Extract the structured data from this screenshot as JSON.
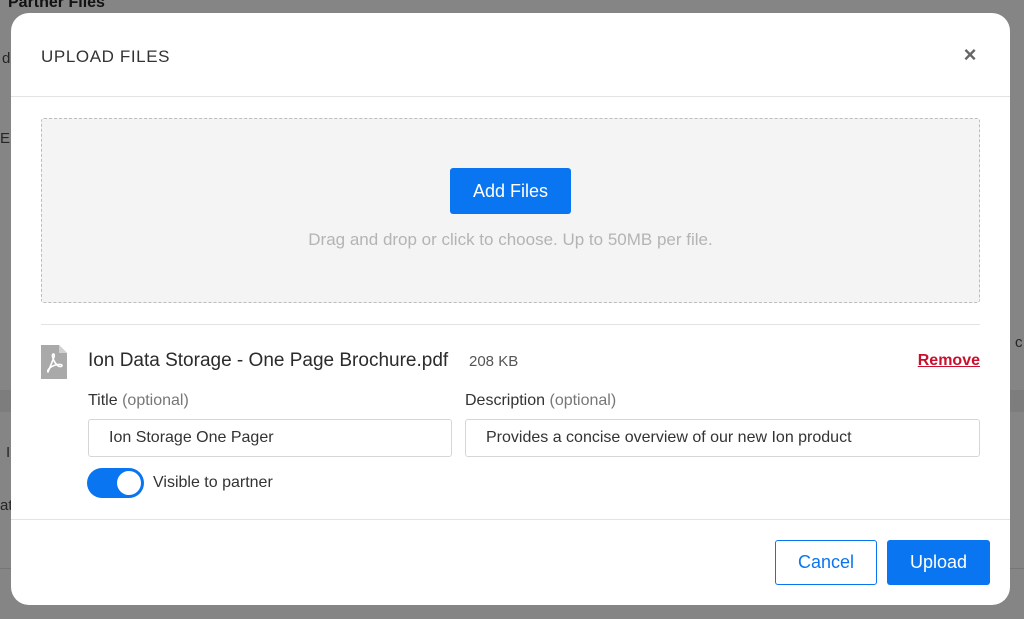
{
  "background": {
    "page_title": "Partner Files",
    "fragments": [
      "d",
      "E",
      "I",
      "at",
      "c"
    ]
  },
  "modal": {
    "title": "UPLOAD FILES",
    "close_icon": "close-icon",
    "close_glyph": "×"
  },
  "dropzone": {
    "add_files_label": "Add Files",
    "hint": "Drag and drop or click to choose. Up to 50MB per file."
  },
  "file": {
    "icon": "pdf-file-icon",
    "name": "Ion Data Storage - One Page Brochure.pdf",
    "size": "208 KB",
    "remove_label": "Remove",
    "title_label": "Title",
    "title_optional": "(optional)",
    "title_value": "Ion Storage One Pager",
    "description_label": "Description",
    "description_optional": "(optional)",
    "description_value": "Provides a concise overview of our new Ion product",
    "visible_label": "Visible to partner",
    "visible": true
  },
  "footer": {
    "cancel_label": "Cancel",
    "upload_label": "Upload"
  },
  "colors": {
    "accent": "#0a75f0",
    "danger": "#c8102e"
  }
}
